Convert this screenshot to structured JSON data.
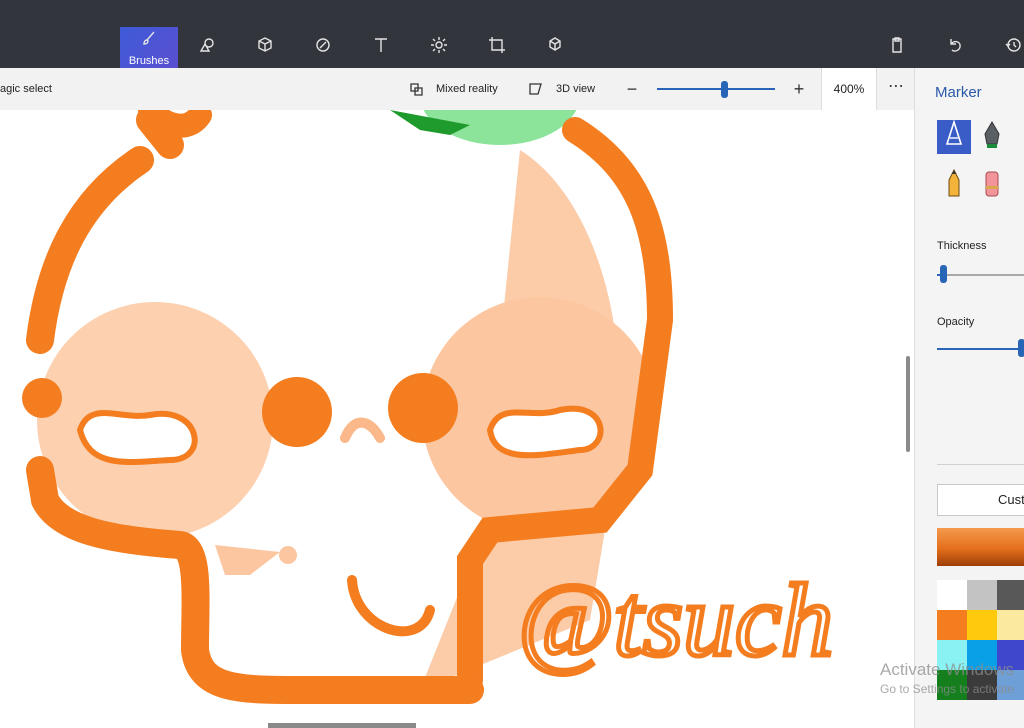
{
  "toolbar": {
    "active_tool_label": "Brushes"
  },
  "subbar": {
    "magic_select": "agic select",
    "mixed_reality": "Mixed reality",
    "view_3d": "3D view",
    "zoom_value": "400%",
    "zoom_fraction": 0.57,
    "more": "⋯",
    "zoom_minus": "−",
    "zoom_plus": "+"
  },
  "panel": {
    "title": "Marker",
    "thickness_label": "Thickness",
    "thickness_fraction": 0.05,
    "opacity_label": "Opacity",
    "opacity_fraction": 1.0,
    "custom_label": "Cust",
    "current_color": "#f07a24"
  },
  "palette": [
    "#ffffff",
    "#c3c3c3",
    "#585858",
    "#f47d20",
    "#ffc90e",
    "#fbe9a0",
    "#8af2f2",
    "#0aa0e8",
    "#3f48cc",
    "#157f1e",
    "#3b3b3b",
    "#6e9fd6"
  ],
  "watermark": {
    "line1": "Activate Windows",
    "line2": "Go to Settings to activate"
  },
  "canvas_text": "@tsuch",
  "colors": {
    "orange": "#f47d20",
    "light_orange": "#fdd0b0",
    "green": "#3cb44a"
  }
}
